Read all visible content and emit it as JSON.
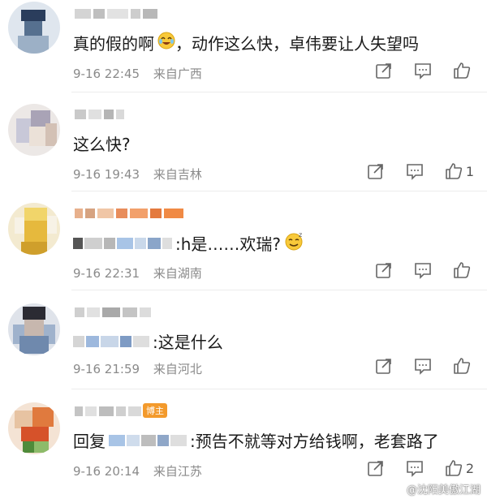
{
  "comments": [
    {
      "text": "真的假的啊",
      "text_after_emoji": "，动作这么快，卓伟要让人失望吗",
      "date": "9-16 22:45",
      "location": "来自广西",
      "likes": ""
    },
    {
      "text": "这么快?",
      "date": "9-16 19:43",
      "location": "来自吉林",
      "likes": "1"
    },
    {
      "text": ":h是……欢瑞?",
      "date": "9-16 22:31",
      "location": "来自湖南",
      "likes": ""
    },
    {
      "text": ":这是什么",
      "date": "9-16 21:59",
      "location": "来自河北",
      "likes": ""
    },
    {
      "reply_prefix": "回复",
      "text": ":预告不就等对方给钱啊，老套路了",
      "date": "9-16 20:14",
      "location": "来自江苏",
      "likes": "2",
      "badge": "博主"
    }
  ],
  "watermark": "@沈阳美傲江湖",
  "icons": {
    "share": "share-icon",
    "comment": "comment-icon",
    "like": "thumbs-up-icon"
  }
}
